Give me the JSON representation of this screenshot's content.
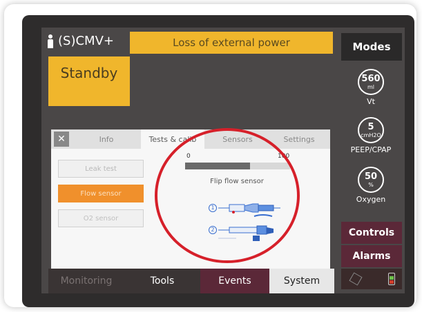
{
  "header": {
    "mode": "(S)CMV+",
    "alarm_message": "Loss of external power",
    "status": "Standby"
  },
  "right_panel": {
    "modes_label": "Modes",
    "parameters": [
      {
        "value": "560",
        "unit": "ml",
        "label": "Vt"
      },
      {
        "value": "5",
        "unit": "cmH2O",
        "label": "PEEP/CPAP"
      },
      {
        "value": "50",
        "unit": "%",
        "label": "Oxygen"
      }
    ],
    "controls_label": "Controls",
    "alarms_label": "Alarms"
  },
  "bottom_tabs": [
    {
      "label": "Monitoring"
    },
    {
      "label": "Tools"
    },
    {
      "label": "Events"
    },
    {
      "label": "System"
    }
  ],
  "dialog": {
    "close_icon": "close-icon",
    "tabs": [
      {
        "label": "Info"
      },
      {
        "label": "Tests & calib"
      },
      {
        "label": "Sensors"
      },
      {
        "label": "Settings"
      }
    ],
    "buttons": {
      "leak_test": "Leak test",
      "flow_sensor": "Flow sensor",
      "o2_sensor": "O2 sensor"
    },
    "progress": {
      "min_label": "0",
      "max_label": "100",
      "value_percent": 62
    },
    "instruction": "Flip flow sensor",
    "step_labels": [
      "1",
      "2"
    ]
  },
  "colors": {
    "accent_yellow": "#f0b62c",
    "accent_orange": "#f0902c",
    "accent_burgundy": "#5b2838",
    "highlight_red": "#d6202a"
  }
}
